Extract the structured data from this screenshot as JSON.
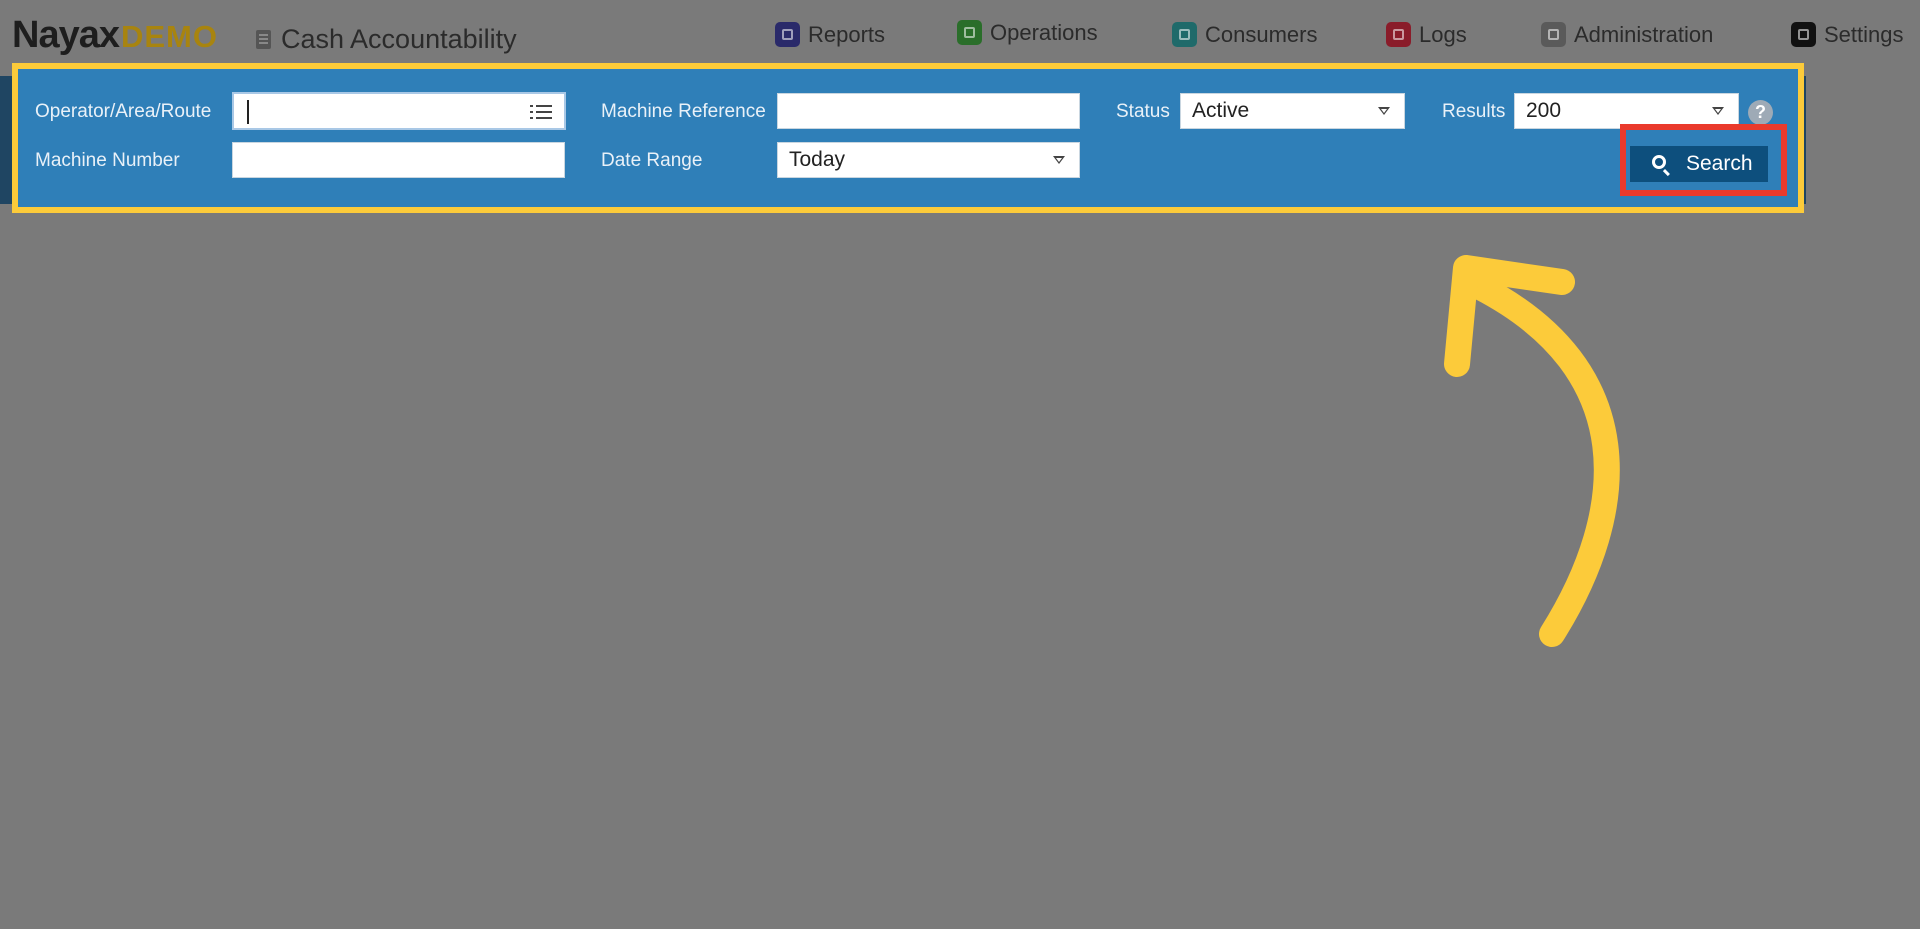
{
  "brand": {
    "name": "Nayax",
    "tag": "DEMO"
  },
  "page": {
    "title": "Cash Accountability"
  },
  "nav": [
    {
      "label": "Reports",
      "icon": "reports-icon"
    },
    {
      "label": "Operations",
      "icon": "operations-icon"
    },
    {
      "label": "Consumers",
      "icon": "consumers-icon"
    },
    {
      "label": "Logs",
      "icon": "logs-icon"
    },
    {
      "label": "Administration",
      "icon": "administration-icon"
    },
    {
      "label": "Settings",
      "icon": "settings-icon"
    }
  ],
  "filters": {
    "operator_label": "Operator/Area/Route",
    "operator_value": "",
    "machine_reference_label": "Machine Reference",
    "machine_reference_value": "",
    "status_label": "Status",
    "status_value": "Active",
    "results_label": "Results",
    "results_value": "200",
    "machine_number_label": "Machine Number",
    "machine_number_value": "",
    "date_range_label": "Date Range",
    "date_range_value": "Today",
    "help_glyph": "?",
    "search_label": "Search"
  },
  "colors": {
    "panel": "#2f7fb8",
    "band": "#1f4562",
    "search_button": "#0d4f7d",
    "highlight_yellow": "#fccb3a",
    "highlight_red": "#ea3a2c",
    "overlay": "#7a7a7a"
  }
}
